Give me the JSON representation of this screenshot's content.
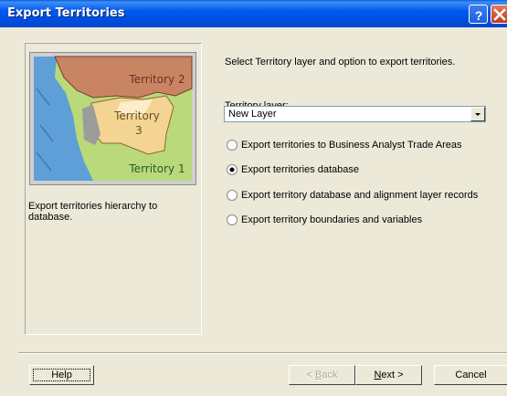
{
  "window": {
    "title": "Export Territories"
  },
  "illustration": {
    "territory2": "Territory 2",
    "territory3_line1": "Territory",
    "territory3_line2": "3",
    "territory1": "Territory 1"
  },
  "left_description": "Export territories hierarchy to database.",
  "main": {
    "prompt": "Select Territory layer and option to export territories.",
    "layer_label": "Territory layer:",
    "layer_value": "New Layer",
    "options": [
      {
        "label": "Export territories to Business Analyst Trade Areas",
        "selected": false
      },
      {
        "label": "Export territories database",
        "selected": true
      },
      {
        "label": "Export territory database and alignment layer records",
        "selected": false
      },
      {
        "label": "Export territory boundaries and variables",
        "selected": false
      }
    ]
  },
  "buttons": {
    "help": "Help",
    "back_mnemonic": "B",
    "back_rest": "ack",
    "back_prefix": "< ",
    "next_mnemonic": "N",
    "next_rest": "ext >",
    "cancel": "Cancel"
  },
  "colors": {
    "titlebar": "#0054e3",
    "territory1": "#b9d97a",
    "territory2": "#c98563",
    "territory3": "#f3d493",
    "water": "#5d9fd6"
  }
}
